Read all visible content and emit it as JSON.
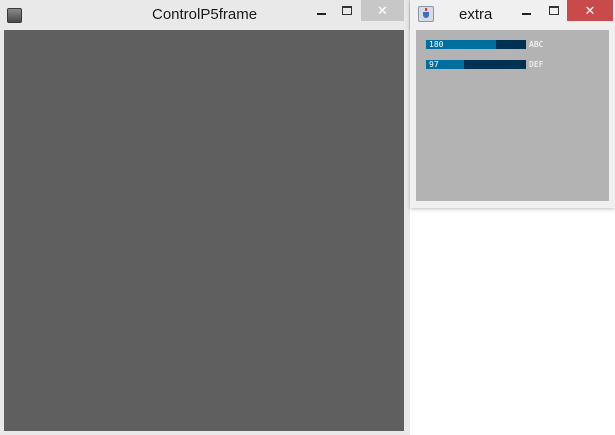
{
  "main_window": {
    "title": "ControlP5frame",
    "icon": "app-icon",
    "canvas_color": "#5f5f5f",
    "buttons": {
      "minimize": "minimize-icon",
      "maximize": "maximize-icon",
      "close_label": "✕"
    }
  },
  "extra_window": {
    "title": "extra",
    "icon": "java-icon",
    "canvas_color": "#b3b3b3",
    "buttons": {
      "minimize": "minimize-icon",
      "maximize": "maximize-icon",
      "close_label": "✕"
    },
    "sliders": [
      {
        "label": "ABC",
        "value": "180",
        "fill_fraction": 0.7
      },
      {
        "label": "DEF",
        "value": "97",
        "fill_fraction": 0.38
      }
    ]
  },
  "colors": {
    "slider_background": "#003052",
    "slider_foreground": "#016ea0",
    "close_active": "#c94a4a"
  }
}
